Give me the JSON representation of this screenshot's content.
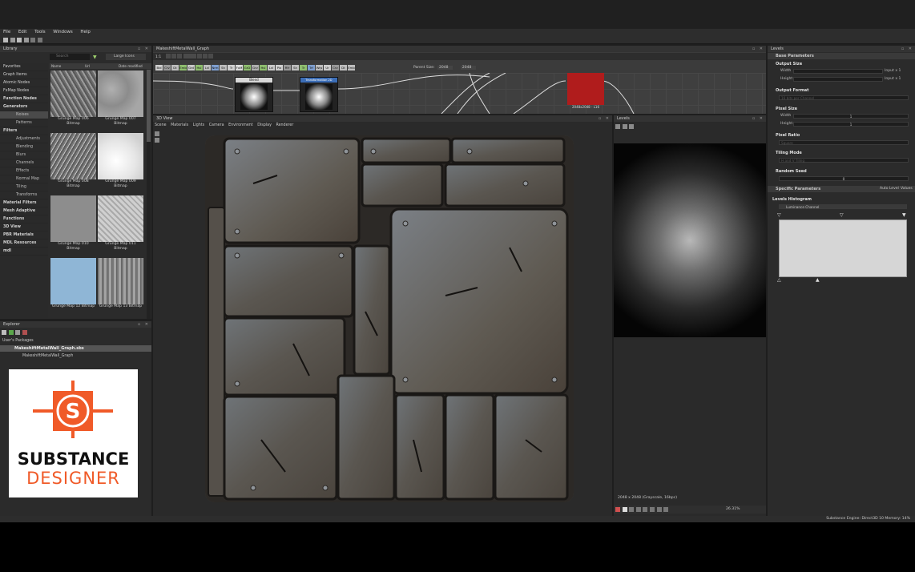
{
  "menu": {
    "items": [
      "File",
      "Edit",
      "Tools",
      "Windows",
      "Help"
    ]
  },
  "library": {
    "title": "Library",
    "search_placeholder": "Search",
    "view_mode": "Large Icons",
    "columns": [
      "Name",
      "Url",
      "Date modified"
    ],
    "categories": [
      {
        "label": "Favorites",
        "level": 0,
        "bold": false
      },
      {
        "label": "Graph Items",
        "level": 0,
        "bold": false
      },
      {
        "label": "Atomic Nodes",
        "level": 0,
        "bold": false
      },
      {
        "label": "FxMap Nodes",
        "level": 0,
        "bold": false
      },
      {
        "label": "Function Nodes",
        "level": 0,
        "bold": true
      },
      {
        "label": "Generators",
        "level": 0,
        "bold": true
      },
      {
        "label": "Noises",
        "level": 1,
        "bold": false,
        "selected": true
      },
      {
        "label": "Patterns",
        "level": 1,
        "bold": false
      },
      {
        "label": "Filters",
        "level": 0,
        "bold": true
      },
      {
        "label": "Adjustments",
        "level": 1,
        "bold": false
      },
      {
        "label": "Blending",
        "level": 1,
        "bold": false
      },
      {
        "label": "Blurs",
        "level": 1,
        "bold": false
      },
      {
        "label": "Channels",
        "level": 1,
        "bold": false
      },
      {
        "label": "Effects",
        "level": 1,
        "bold": false
      },
      {
        "label": "Normal Map",
        "level": 1,
        "bold": false
      },
      {
        "label": "Tiling",
        "level": 1,
        "bold": false
      },
      {
        "label": "Transforms",
        "level": 1,
        "bold": false
      },
      {
        "label": "Material Filters",
        "level": 0,
        "bold": true
      },
      {
        "label": "Mesh Adaptive",
        "level": 0,
        "bold": true
      },
      {
        "label": "Functions",
        "level": 0,
        "bold": true
      },
      {
        "label": "3D View",
        "level": 0,
        "bold": true
      },
      {
        "label": "PBR Materials",
        "level": 0,
        "bold": true
      },
      {
        "label": "MDL Resources",
        "level": 0,
        "bold": true
      },
      {
        "label": "mdl",
        "level": 0,
        "bold": true
      }
    ],
    "thumbnails": [
      {
        "line1": "Grunge Map 006",
        "line2": "Bitmap"
      },
      {
        "line1": "Grunge Map 007",
        "line2": "Bitmap"
      },
      {
        "line1": "Grunge Map 008",
        "line2": "Bitmap"
      },
      {
        "line1": "Grunge Map 009",
        "line2": "Bitmap"
      },
      {
        "line1": "Grunge Map 010",
        "line2": "Bitmap"
      },
      {
        "line1": "Grunge Map 011",
        "line2": "Bitmap"
      },
      {
        "line1": "Grunge Map 12 Bitmap",
        "line2": ""
      },
      {
        "line1": "Grunge Map 13 Bitmap",
        "line2": ""
      }
    ]
  },
  "explorer": {
    "title": "Explorer",
    "section": "User's Packages",
    "package": "MakeshiftMetalWall_Graph.sbs",
    "graph": "MakeshiftMetalWall_Graph"
  },
  "logo": {
    "line1": "SUBSTANCE",
    "line2": "DESIGNER",
    "accent": "#f05a28"
  },
  "graph": {
    "title": "MakeshiftMetalWall_Graph",
    "zoom": "1:1",
    "parent_size_label": "Parent Size:",
    "parent_size_value": "2048",
    "size_value": "2048",
    "node_chips": [
      "Bld",
      "Crv",
      "Dt",
      "Emb",
      "Grd",
      "Hsl",
      "Lvl",
      "Nrm",
      "Sh",
      "Tr",
      "FxM",
      "GrD",
      "Grv",
      "Hsl",
      "Lvl",
      "Pix",
      "Rfr",
      "Sh",
      "Tr",
      "Trf",
      "Wrp",
      "Ur",
      "Crv",
      "Dt",
      "Emb"
    ],
    "nodes": [
      {
        "title": "Blend",
        "type": "node"
      },
      {
        "title": "Transformation 2D",
        "type": "node"
      }
    ],
    "output_node_label": "2048x2048 - L16"
  },
  "view3d": {
    "title": "3D View",
    "menu": [
      "Scene",
      "Materials",
      "Lights",
      "Camera",
      "Environment",
      "Display",
      "Renderer"
    ]
  },
  "levels_view": {
    "title": "Levels",
    "info": "2048 x 2048 (Grayscale, 16bpc)",
    "zoom": "26.31%"
  },
  "params": {
    "title": "Levels",
    "base_section": "Base Parameters",
    "output_size": {
      "label": "Output Size",
      "width_label": "Width",
      "height_label": "Height",
      "width_mode": "Input x 1",
      "height_mode": "Input x 1"
    },
    "output_format": {
      "label": "Output Format",
      "value": "16 bits per Channel"
    },
    "pixel_size": {
      "label": "Pixel Size",
      "width_label": "Width",
      "height_label": "Height",
      "width_value": "1",
      "height_value": "1"
    },
    "pixel_ratio": {
      "label": "Pixel Ratio",
      "value": "Square"
    },
    "tiling_mode": {
      "label": "Tiling Mode",
      "value": "H and V Tiling"
    },
    "random_seed": {
      "label": "Random Seed",
      "value": "0"
    },
    "specific_section": "Specific Parameters",
    "auto_level": "Auto Level",
    "values_label": "Values",
    "histogram_label": "Levels Histogram",
    "channel": "Luminance Channel"
  },
  "status": {
    "text": "Substance Engine: Direct3D 10  Memory: 14%"
  }
}
